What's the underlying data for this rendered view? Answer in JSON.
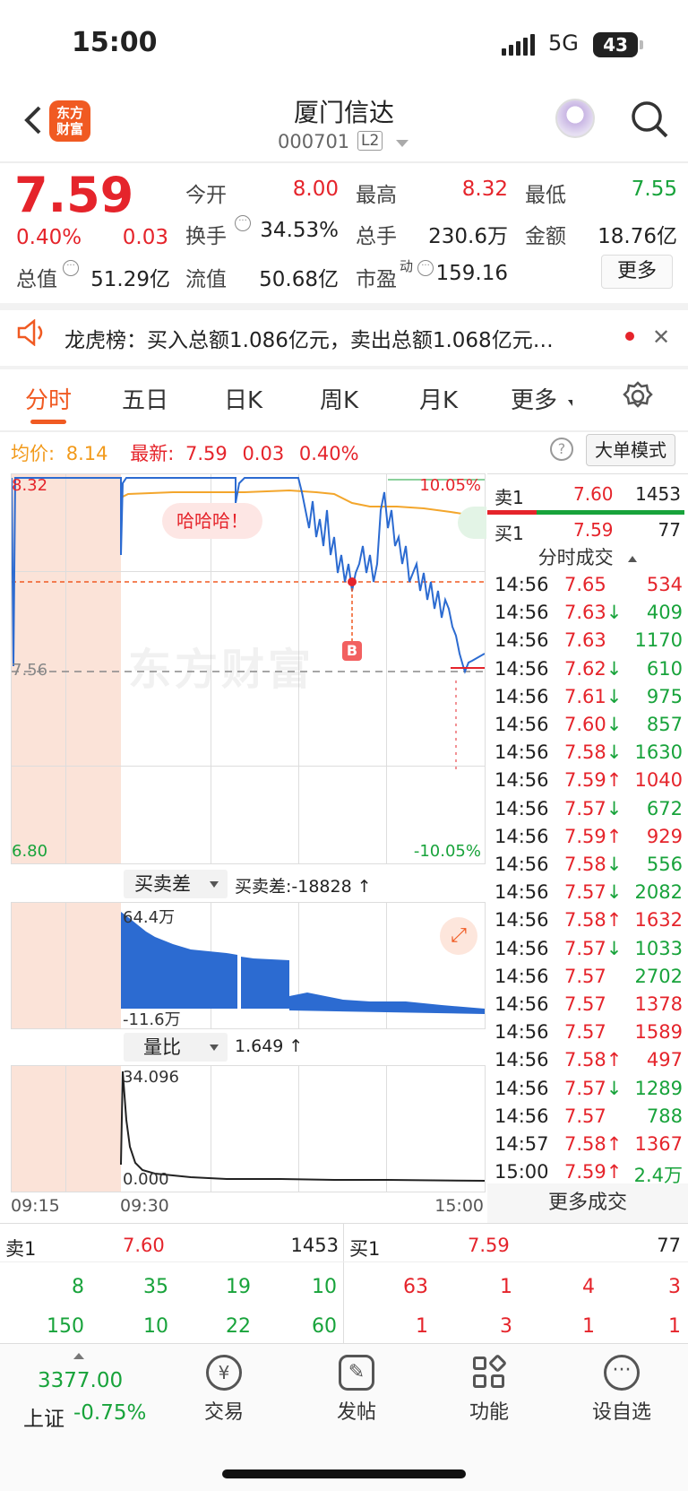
{
  "status": {
    "time": "15:00",
    "network": "5G",
    "battery": "43"
  },
  "header": {
    "title": "厦门信达",
    "code": "000701",
    "level": "L2",
    "logo": "东方财富"
  },
  "quote": {
    "price": "7.59",
    "pct": "0.40%",
    "change": "0.03",
    "open_label": "今开",
    "open": "8.00",
    "high_label": "最高",
    "high": "8.32",
    "low_label": "最低",
    "low": "7.55",
    "turnover_label": "换手",
    "turnover": "34.53%",
    "vol_label": "总手",
    "vol": "230.6万",
    "amt_label": "金额",
    "amt": "18.76亿",
    "mcap_label": "总值",
    "mcap": "51.29亿",
    "float_label": "流值",
    "float": "50.68亿",
    "pe_label": "市盈",
    "pe_sup": "动",
    "pe": "159.16",
    "more": "更多"
  },
  "news": {
    "text": "龙虎榜：买入总额1.086亿元，卖出总额1.068亿元…"
  },
  "tabs": [
    "分时",
    "五日",
    "日K",
    "周K",
    "月K",
    "更多"
  ],
  "intraday": {
    "avg_label": "均价:",
    "avg": "8.14",
    "latest_label": "最新:",
    "latest": "7.59",
    "chg": "0.03",
    "pct": "0.40%",
    "mode": "大单模式",
    "hi": "8.32",
    "lo": "6.80",
    "mid": "7.56",
    "hi_pct": "10.05%",
    "lo_pct": "-10.05%",
    "bubble": "哈哈哈！",
    "marker": "B",
    "watermark": "东方财富"
  },
  "sub1": {
    "select": "买卖差",
    "label": "买卖差:-18828 ↑",
    "top": "64.4万",
    "bottom": "-11.6万"
  },
  "sub2": {
    "select": "量比",
    "label": "1.649 ↑",
    "top": "34.096",
    "bottom": "0.000"
  },
  "times": [
    "09:15",
    "09:30",
    "15:00"
  ],
  "book_side": {
    "sell_label": "卖1",
    "sell_price": "7.60",
    "sell_vol": "1453",
    "buy_label": "买1",
    "buy_price": "7.59",
    "buy_vol": "77"
  },
  "trades": {
    "title": "分时成交",
    "rows": [
      {
        "t": "14:56",
        "p": "7.65",
        "a": "",
        "v": "534",
        "c": "red",
        "vc": "red"
      },
      {
        "t": "14:56",
        "p": "7.63",
        "a": "↓",
        "v": "409",
        "c": "red",
        "vc": "green"
      },
      {
        "t": "14:56",
        "p": "7.63",
        "a": "",
        "v": "1170",
        "c": "red",
        "vc": "green"
      },
      {
        "t": "14:56",
        "p": "7.62",
        "a": "↓",
        "v": "610",
        "c": "red",
        "vc": "green"
      },
      {
        "t": "14:56",
        "p": "7.61",
        "a": "↓",
        "v": "975",
        "c": "red",
        "vc": "green"
      },
      {
        "t": "14:56",
        "p": "7.60",
        "a": "↓",
        "v": "857",
        "c": "red",
        "vc": "green"
      },
      {
        "t": "14:56",
        "p": "7.58",
        "a": "↓",
        "v": "1630",
        "c": "red",
        "vc": "green"
      },
      {
        "t": "14:56",
        "p": "7.59",
        "a": "↑",
        "v": "1040",
        "c": "red",
        "vc": "red"
      },
      {
        "t": "14:56",
        "p": "7.57",
        "a": "↓",
        "v": "672",
        "c": "red",
        "vc": "green"
      },
      {
        "t": "14:56",
        "p": "7.59",
        "a": "↑",
        "v": "929",
        "c": "red",
        "vc": "red"
      },
      {
        "t": "14:56",
        "p": "7.58",
        "a": "↓",
        "v": "556",
        "c": "red",
        "vc": "green"
      },
      {
        "t": "14:56",
        "p": "7.57",
        "a": "↓",
        "v": "2082",
        "c": "red",
        "vc": "green"
      },
      {
        "t": "14:56",
        "p": "7.58",
        "a": "↑",
        "v": "1632",
        "c": "red",
        "vc": "red"
      },
      {
        "t": "14:56",
        "p": "7.57",
        "a": "↓",
        "v": "1033",
        "c": "red",
        "vc": "green"
      },
      {
        "t": "14:56",
        "p": "7.57",
        "a": "",
        "v": "2702",
        "c": "red",
        "vc": "green"
      },
      {
        "t": "14:56",
        "p": "7.57",
        "a": "",
        "v": "1378",
        "c": "red",
        "vc": "red"
      },
      {
        "t": "14:56",
        "p": "7.57",
        "a": "",
        "v": "1589",
        "c": "red",
        "vc": "red"
      },
      {
        "t": "14:56",
        "p": "7.58",
        "a": "↑",
        "v": "497",
        "c": "red",
        "vc": "red"
      },
      {
        "t": "14:56",
        "p": "7.57",
        "a": "↓",
        "v": "1289",
        "c": "red",
        "vc": "green"
      },
      {
        "t": "14:56",
        "p": "7.57",
        "a": "",
        "v": "788",
        "c": "red",
        "vc": "green"
      },
      {
        "t": "14:57",
        "p": "7.58",
        "a": "↑",
        "v": "1367",
        "c": "red",
        "vc": "red"
      },
      {
        "t": "15:00",
        "p": "7.59",
        "a": "↑",
        "v": "2.4万",
        "c": "red",
        "vc": "green"
      }
    ],
    "more": "更多成交"
  },
  "book_bottom": {
    "sell_label": "卖1",
    "sell_price": "7.60",
    "sell_vol": "1453",
    "buy_label": "买1",
    "buy_price": "7.59",
    "buy_vol": "77",
    "sell_r1": [
      "8",
      "35",
      "19",
      "10"
    ],
    "sell_r2": [
      "150",
      "10",
      "22",
      "60"
    ],
    "buy_r1": [
      "63",
      "1",
      "4",
      "3"
    ],
    "buy_r2": [
      "1",
      "3",
      "1",
      "1"
    ]
  },
  "nav": {
    "index_value": "3377.00",
    "index_name": "上证",
    "index_chg": "-0.75%",
    "trade": "交易",
    "post": "发帖",
    "func": "功能",
    "watch": "设自选"
  }
}
